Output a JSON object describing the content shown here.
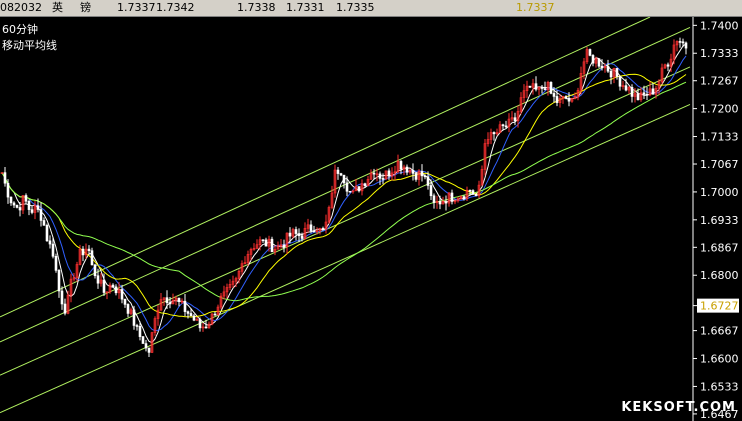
{
  "quote_bar": {
    "code": "082032",
    "name_1": "英",
    "name_2": "镑",
    "price_1": "1.7337",
    "price_2": "1.7342",
    "price_3": "1.7338",
    "price_4": "1.7331",
    "price_5": "1.7335",
    "price_6": "1.7337"
  },
  "legend": {
    "period": "60分钟",
    "indicator": "移动平均线"
  },
  "watermark": "KEKSOFT.COM",
  "colors": {
    "background": "#000000",
    "up_candle": "#ff3030",
    "down_candle": "#ffffff",
    "channel": "#b0f060",
    "ma_short": "#ffffff",
    "ma_mid": "#ffff00",
    "ma_long": "#3060ff",
    "ma_longest": "#90ff50",
    "axis": "#ffffff",
    "current_price_box": "#ffffff",
    "current_price_text": "#ffff00"
  },
  "chart_data": {
    "type": "candlestick",
    "title": "",
    "y_ticks": [
      "1.7400",
      "1.7333",
      "1.7267",
      "1.7200",
      "1.7133",
      "1.7067",
      "1.7000",
      "1.6933",
      "1.6867",
      "1.6800",
      "1.6727",
      "1.6667",
      "1.6600",
      "1.6533",
      "1.6467"
    ],
    "ylim": [
      1.645,
      1.742
    ],
    "current_price": "1.6727",
    "price_path": [
      [
        0,
        1.7065
      ],
      [
        6,
        1.701
      ],
      [
        12,
        1.6975
      ],
      [
        18,
        1.696
      ],
      [
        24,
        1.6985
      ],
      [
        30,
        1.6955
      ],
      [
        36,
        1.696
      ],
      [
        42,
        1.694
      ],
      [
        48,
        1.688
      ],
      [
        54,
        1.685
      ],
      [
        58,
        1.677
      ],
      [
        62,
        1.674
      ],
      [
        66,
        1.6715
      ],
      [
        72,
        1.679
      ],
      [
        80,
        1.685
      ],
      [
        88,
        1.687
      ],
      [
        92,
        1.682
      ],
      [
        96,
        1.68
      ],
      [
        104,
        1.676
      ],
      [
        112,
        1.678
      ],
      [
        120,
        1.6755
      ],
      [
        126,
        1.673
      ],
      [
        132,
        1.67
      ],
      [
        138,
        1.666
      ],
      [
        144,
        1.664
      ],
      [
        148,
        1.6605
      ],
      [
        154,
        1.668
      ],
      [
        160,
        1.675
      ],
      [
        168,
        1.6745
      ],
      [
        176,
        1.674
      ],
      [
        184,
        1.672
      ],
      [
        192,
        1.67
      ],
      [
        200,
        1.6675
      ],
      [
        206,
        1.668
      ],
      [
        212,
        1.67
      ],
      [
        220,
        1.674
      ],
      [
        228,
        1.676
      ],
      [
        236,
        1.6785
      ],
      [
        244,
        1.684
      ],
      [
        252,
        1.687
      ],
      [
        260,
        1.688
      ],
      [
        268,
        1.6875
      ],
      [
        276,
        1.6865
      ],
      [
        284,
        1.688
      ],
      [
        292,
        1.69
      ],
      [
        300,
        1.6895
      ],
      [
        308,
        1.691
      ],
      [
        316,
        1.692
      ],
      [
        322,
        1.69
      ],
      [
        328,
        1.6935
      ],
      [
        334,
        1.704
      ],
      [
        340,
        1.706
      ],
      [
        346,
        1.702
      ],
      [
        352,
        1.699
      ],
      [
        358,
        1.701
      ],
      [
        366,
        1.703
      ],
      [
        374,
        1.7055
      ],
      [
        382,
        1.7035
      ],
      [
        390,
        1.705
      ],
      [
        398,
        1.707
      ],
      [
        406,
        1.706
      ],
      [
        414,
        1.7045
      ],
      [
        422,
        1.704
      ],
      [
        428,
        1.702
      ],
      [
        432,
        1.6965
      ],
      [
        438,
        1.6975
      ],
      [
        446,
        1.6985
      ],
      [
        454,
        1.699
      ],
      [
        462,
        1.6995
      ],
      [
        470,
        1.7005
      ],
      [
        476,
        1.699
      ],
      [
        480,
        1.701
      ],
      [
        486,
        1.714
      ],
      [
        492,
        1.713
      ],
      [
        500,
        1.715
      ],
      [
        508,
        1.716
      ],
      [
        516,
        1.7175
      ],
      [
        522,
        1.723
      ],
      [
        530,
        1.725
      ],
      [
        538,
        1.724
      ],
      [
        546,
        1.726
      ],
      [
        552,
        1.723
      ],
      [
        558,
        1.7215
      ],
      [
        566,
        1.7225
      ],
      [
        574,
        1.721
      ],
      [
        580,
        1.728
      ],
      [
        586,
        1.733
      ],
      [
        592,
        1.732
      ],
      [
        600,
        1.731
      ],
      [
        608,
        1.7295
      ],
      [
        616,
        1.728
      ],
      [
        622,
        1.726
      ],
      [
        628,
        1.725
      ],
      [
        634,
        1.723
      ],
      [
        640,
        1.7225
      ],
      [
        646,
        1.7235
      ],
      [
        652,
        1.724
      ],
      [
        658,
        1.726
      ],
      [
        664,
        1.73
      ],
      [
        670,
        1.732
      ],
      [
        676,
        1.737
      ],
      [
        682,
        1.736
      ],
      [
        688,
        1.7345
      ]
    ]
  }
}
